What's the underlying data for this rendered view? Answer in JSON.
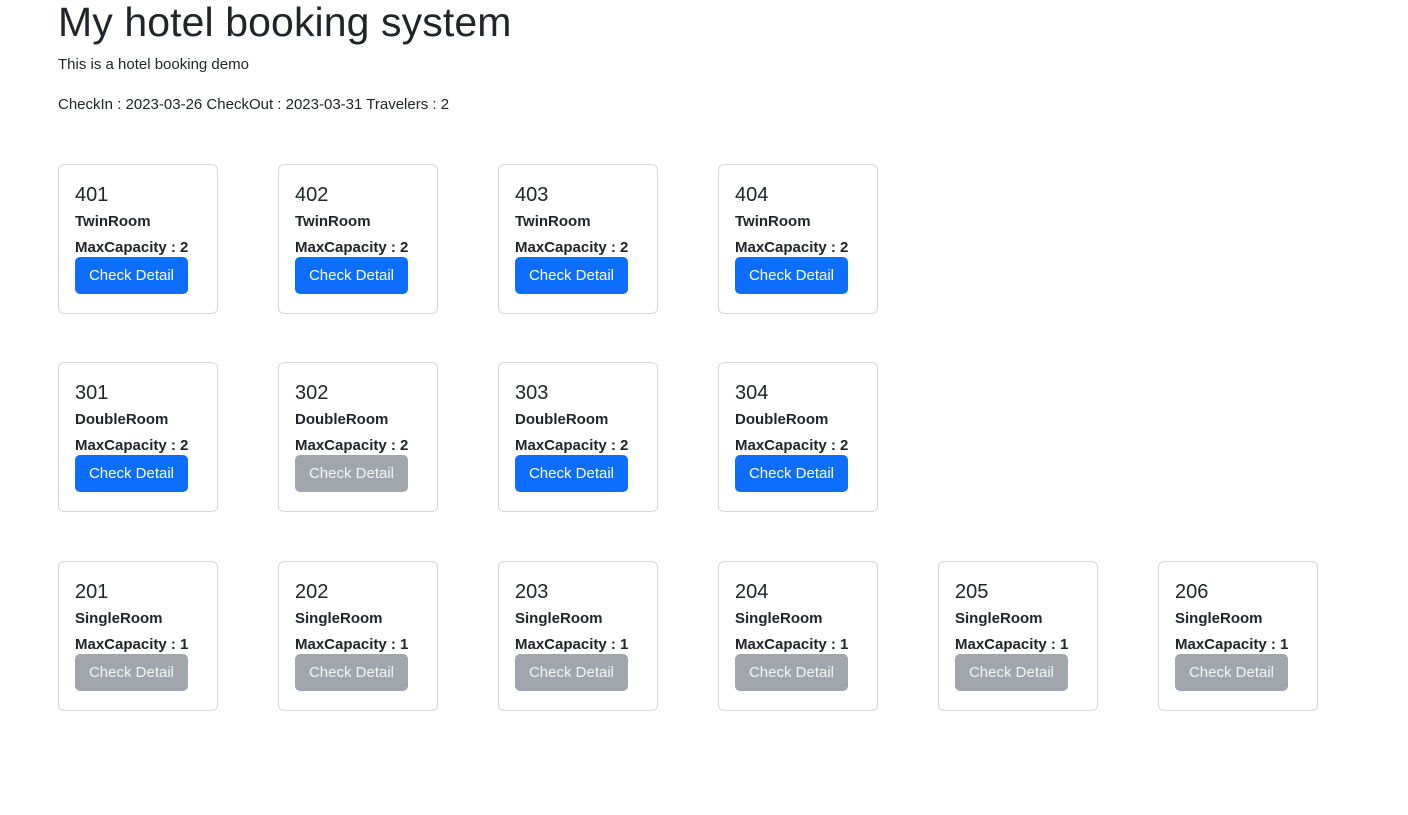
{
  "header": {
    "title": "My hotel booking system",
    "subtitle": "This is a hotel booking demo",
    "booking_info": "CheckIn : 2023-03-26 CheckOut : 2023-03-31 Travelers : 2"
  },
  "colors": {
    "available_button": "#0d6efd",
    "unavailable_button": "#a1a6ac"
  },
  "rows": [
    {
      "rooms": [
        {
          "number": "401",
          "type": "TwinRoom",
          "capacity": "MaxCapacity : 2",
          "button": "Check Detail",
          "available": true
        },
        {
          "number": "402",
          "type": "TwinRoom",
          "capacity": "MaxCapacity : 2",
          "button": "Check Detail",
          "available": true
        },
        {
          "number": "403",
          "type": "TwinRoom",
          "capacity": "MaxCapacity : 2",
          "button": "Check Detail",
          "available": true
        },
        {
          "number": "404",
          "type": "TwinRoom",
          "capacity": "MaxCapacity : 2",
          "button": "Check Detail",
          "available": true
        }
      ]
    },
    {
      "rooms": [
        {
          "number": "301",
          "type": "DoubleRoom",
          "capacity": "MaxCapacity : 2",
          "button": "Check Detail",
          "available": true
        },
        {
          "number": "302",
          "type": "DoubleRoom",
          "capacity": "MaxCapacity : 2",
          "button": "Check Detail",
          "available": false
        },
        {
          "number": "303",
          "type": "DoubleRoom",
          "capacity": "MaxCapacity : 2",
          "button": "Check Detail",
          "available": true
        },
        {
          "number": "304",
          "type": "DoubleRoom",
          "capacity": "MaxCapacity : 2",
          "button": "Check Detail",
          "available": true
        }
      ]
    },
    {
      "rooms": [
        {
          "number": "201",
          "type": "SingleRoom",
          "capacity": "MaxCapacity : 1",
          "button": "Check Detail",
          "available": false
        },
        {
          "number": "202",
          "type": "SingleRoom",
          "capacity": "MaxCapacity : 1",
          "button": "Check Detail",
          "available": false
        },
        {
          "number": "203",
          "type": "SingleRoom",
          "capacity": "MaxCapacity : 1",
          "button": "Check Detail",
          "available": false
        },
        {
          "number": "204",
          "type": "SingleRoom",
          "capacity": "MaxCapacity : 1",
          "button": "Check Detail",
          "available": false
        },
        {
          "number": "205",
          "type": "SingleRoom",
          "capacity": "MaxCapacity : 1",
          "button": "Check Detail",
          "available": false
        },
        {
          "number": "206",
          "type": "SingleRoom",
          "capacity": "MaxCapacity : 1",
          "button": "Check Detail",
          "available": false
        }
      ]
    }
  ]
}
